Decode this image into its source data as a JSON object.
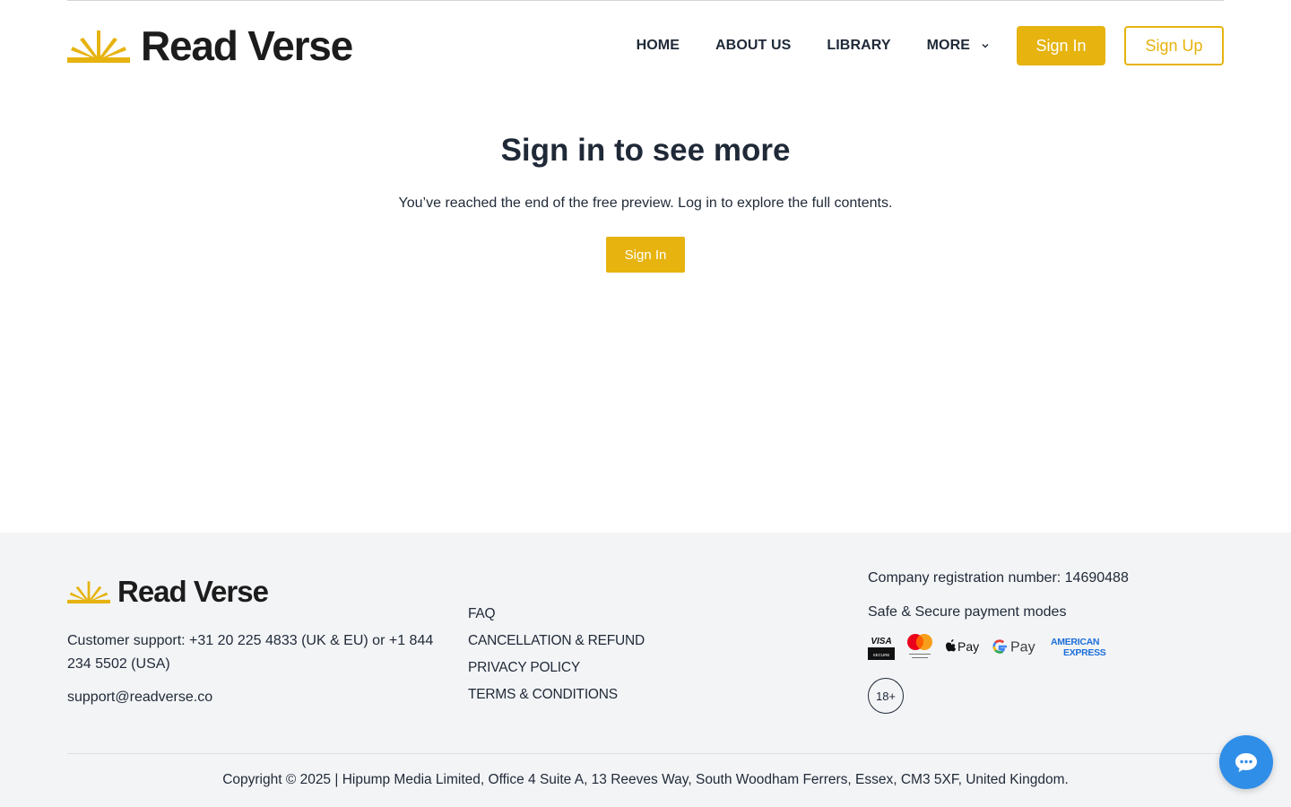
{
  "brand": {
    "name": "Read Verse",
    "accent_color": "#e6b30f",
    "dark_color": "#1c1c1c"
  },
  "nav": {
    "items": [
      {
        "label": "HOME"
      },
      {
        "label": "ABOUT US"
      },
      {
        "label": "LIBRARY"
      }
    ],
    "more_label": "MORE",
    "signin_label": "Sign In",
    "signup_label": "Sign Up"
  },
  "main": {
    "title": "Sign in to see more",
    "subtitle": "You’ve reached the end of the free preview. Log in to explore the full contents.",
    "button_label": "Sign In"
  },
  "footer": {
    "support_text": "Customer support: +31 20 225 4833 (UK & EU) or +1 844 234 5502 (USA)",
    "email": "support@readverse.co",
    "links": [
      {
        "label": "FAQ"
      },
      {
        "label": "CANCELLATION & REFUND"
      },
      {
        "label": "PRIVACY POLICY"
      },
      {
        "label": "TERMS & CONDITIONS"
      }
    ],
    "registration": "Company registration number: 14690488",
    "payment_title": "Safe & Secure payment modes",
    "payment_icons": [
      "visa-secure-icon",
      "mastercard-id-check-icon",
      "apple-pay-icon",
      "google-pay-icon",
      "american-express-icon"
    ],
    "payment_text": {
      "visa": "VISA",
      "visa_secure": "SECURE",
      "apple_pay": "Pay",
      "google_pay": "Pay",
      "amex_line1": "AMERICAN",
      "amex_line2": "EXPRESS"
    },
    "age_badge": "18+",
    "copyright": "Copyright © 2025 | Hipump Media Limited, Office 4 Suite A, 13 Reeves Way, South Woodham Ferrers, Essex, CM3 5XF, United Kingdom."
  },
  "chat": {
    "icon": "chat-bubble-icon",
    "color": "#2f8ee8"
  }
}
